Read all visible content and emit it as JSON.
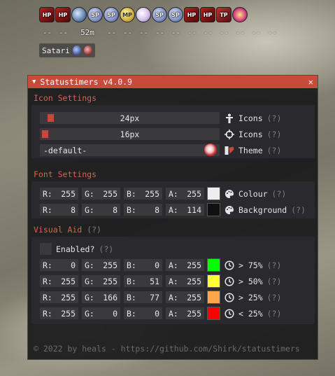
{
  "buffbar": {
    "icons": [
      {
        "type": "hp",
        "label": "HP",
        "name": "hp-potion-icon"
      },
      {
        "type": "hp",
        "label": "HP",
        "name": "hp-potion-icon"
      },
      {
        "type": "orb",
        "label": "",
        "name": "blue-orb-icon"
      },
      {
        "type": "sp",
        "label": "SP",
        "name": "sp-orb-icon"
      },
      {
        "type": "sp",
        "label": "SP",
        "name": "sp-orb-icon"
      },
      {
        "type": "mp",
        "label": "MP",
        "name": "mp-orb-icon"
      },
      {
        "type": "pill",
        "label": "",
        "name": "pill-icon"
      },
      {
        "type": "sp",
        "label": "SP",
        "name": "sp-orb-icon"
      },
      {
        "type": "sp",
        "label": "SP",
        "name": "sp-orb-icon"
      },
      {
        "type": "hp",
        "label": "HP",
        "name": "hp-potion-icon"
      },
      {
        "type": "hp",
        "label": "HP",
        "name": "hp-potion-icon"
      },
      {
        "type": "tp",
        "label": "TP",
        "name": "tp-potion-icon"
      },
      {
        "type": "star",
        "label": "",
        "name": "star-burst-icon"
      }
    ],
    "timers": [
      "--",
      "--",
      "52m",
      "--",
      "--",
      "--",
      "--",
      "--",
      "--",
      "--",
      "--",
      "--",
      "--",
      "--"
    ],
    "target_name": "Satari"
  },
  "window": {
    "title": "Statustimers v4.0.9",
    "collapse_icon": "triangle-down",
    "close_label": "✕"
  },
  "icon_settings": {
    "header": "Icon Settings",
    "size_slider": {
      "value": "24px",
      "label": "Icons",
      "help": "(?)",
      "icon": "person-icon",
      "level": 0.0
    },
    "target_slider": {
      "value": "16px",
      "label": "Icons",
      "help": "(?)",
      "icon": "crosshair-icon",
      "level": 0.0
    },
    "theme": {
      "value": "-default-",
      "label": "Theme",
      "help": "(?)",
      "icon": "palette-book-icon"
    }
  },
  "font_settings": {
    "header": "Font Settings",
    "colour": {
      "channels": [
        {
          "key": "R:",
          "val": "255"
        },
        {
          "key": "G:",
          "val": "255"
        },
        {
          "key": "B:",
          "val": "255"
        },
        {
          "key": "A:",
          "val": "255"
        }
      ],
      "swatch": "#eeeeee",
      "label": "Colour",
      "help": "(?)"
    },
    "background": {
      "channels": [
        {
          "key": "R:",
          "val": "8"
        },
        {
          "key": "G:",
          "val": "8"
        },
        {
          "key": "B:",
          "val": "8"
        },
        {
          "key": "A:",
          "val": "114"
        }
      ],
      "swatch": "#111111",
      "label": "Background",
      "help": "(?)"
    }
  },
  "visual_aid": {
    "header": "Visual Aid",
    "header_help": "(?)",
    "enabled_label": "Enabled?",
    "enabled_help": "(?)",
    "rows": [
      {
        "channels": [
          {
            "key": "R:",
            "val": "0"
          },
          {
            "key": "G:",
            "val": "255"
          },
          {
            "key": "B:",
            "val": "0"
          },
          {
            "key": "A:",
            "val": "255"
          }
        ],
        "swatch": "#00ff00",
        "label": "> 75%",
        "help": "(?)"
      },
      {
        "channels": [
          {
            "key": "R:",
            "val": "255"
          },
          {
            "key": "G:",
            "val": "255"
          },
          {
            "key": "B:",
            "val": "51"
          },
          {
            "key": "A:",
            "val": "255"
          }
        ],
        "swatch": "#ffff33",
        "label": "> 50%",
        "help": "(?)"
      },
      {
        "channels": [
          {
            "key": "R:",
            "val": "255"
          },
          {
            "key": "G:",
            "val": "166"
          },
          {
            "key": "B:",
            "val": "77"
          },
          {
            "key": "A:",
            "val": "255"
          }
        ],
        "swatch": "#ffa64d",
        "label": "> 25%",
        "help": "(?)"
      },
      {
        "channels": [
          {
            "key": "R:",
            "val": "255"
          },
          {
            "key": "G:",
            "val": "0"
          },
          {
            "key": "B:",
            "val": "0"
          },
          {
            "key": "A:",
            "val": "255"
          }
        ],
        "swatch": "#ff0000",
        "label": "< 25%",
        "help": "(?)"
      }
    ]
  },
  "footer": {
    "copyright_icon": "©",
    "text": "2022 by heals - https://github.com/Shirk/statustimers"
  },
  "colors": {
    "accent": "#c84a3a",
    "section_header": "#d8634f"
  }
}
